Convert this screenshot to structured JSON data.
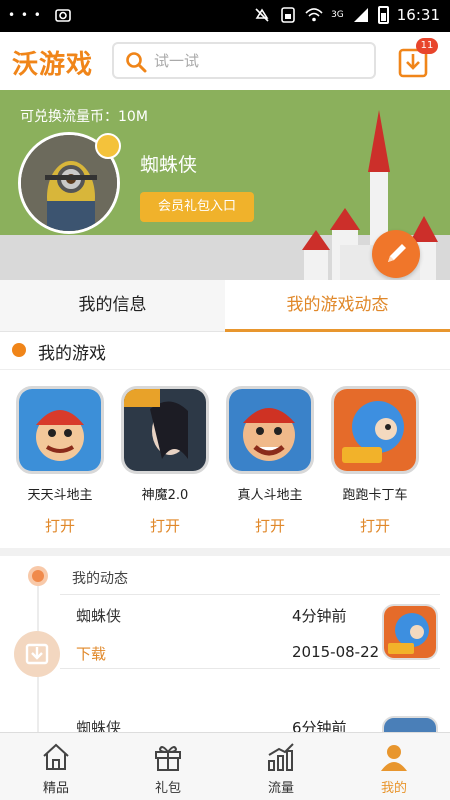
{
  "status_bar": {
    "left_dots": "• • •",
    "time": "16:31",
    "network_label": "3G"
  },
  "header": {
    "logo": "沃游戏",
    "search_placeholder": "试一试",
    "download_badge": "11"
  },
  "profile": {
    "exchange_text": "可兑换流量币：10M",
    "username": "蜘蛛侠",
    "gift_button": "会员礼包入口"
  },
  "tabs": [
    {
      "label": "我的信息",
      "active": false
    },
    {
      "label": "我的游戏动态",
      "active": true
    }
  ],
  "my_games": {
    "title": "我的游戏",
    "open_label": "打开",
    "items": [
      {
        "name": "天天斗地主",
        "icon": "doudizhu-man-icon"
      },
      {
        "name": "神魔2.0",
        "icon": "shenmo-warrior-icon"
      },
      {
        "name": "真人斗地主",
        "icon": "zhenren-doudizhu-icon"
      },
      {
        "name": "跑跑卡丁车",
        "icon": "kart-rider-icon"
      }
    ]
  },
  "activity": {
    "title": "我的动态",
    "entries": [
      {
        "user": "蜘蛛侠",
        "time": "4分钟前",
        "type": "下载",
        "date": "2015-08-22"
      },
      {
        "user": "蜘蛛侠",
        "time": "6分钟前"
      }
    ]
  },
  "bottom_nav": [
    {
      "label": "精品",
      "icon": "home-icon",
      "active": false
    },
    {
      "label": "礼包",
      "icon": "gift-icon",
      "active": false
    },
    {
      "label": "流量",
      "icon": "traffic-chart-icon",
      "active": false
    },
    {
      "label": "我的",
      "icon": "user-icon",
      "active": true
    }
  ],
  "colors": {
    "accent": "#f08519",
    "banner_green": "#8bb05c",
    "active_tab": "#e0882a"
  }
}
